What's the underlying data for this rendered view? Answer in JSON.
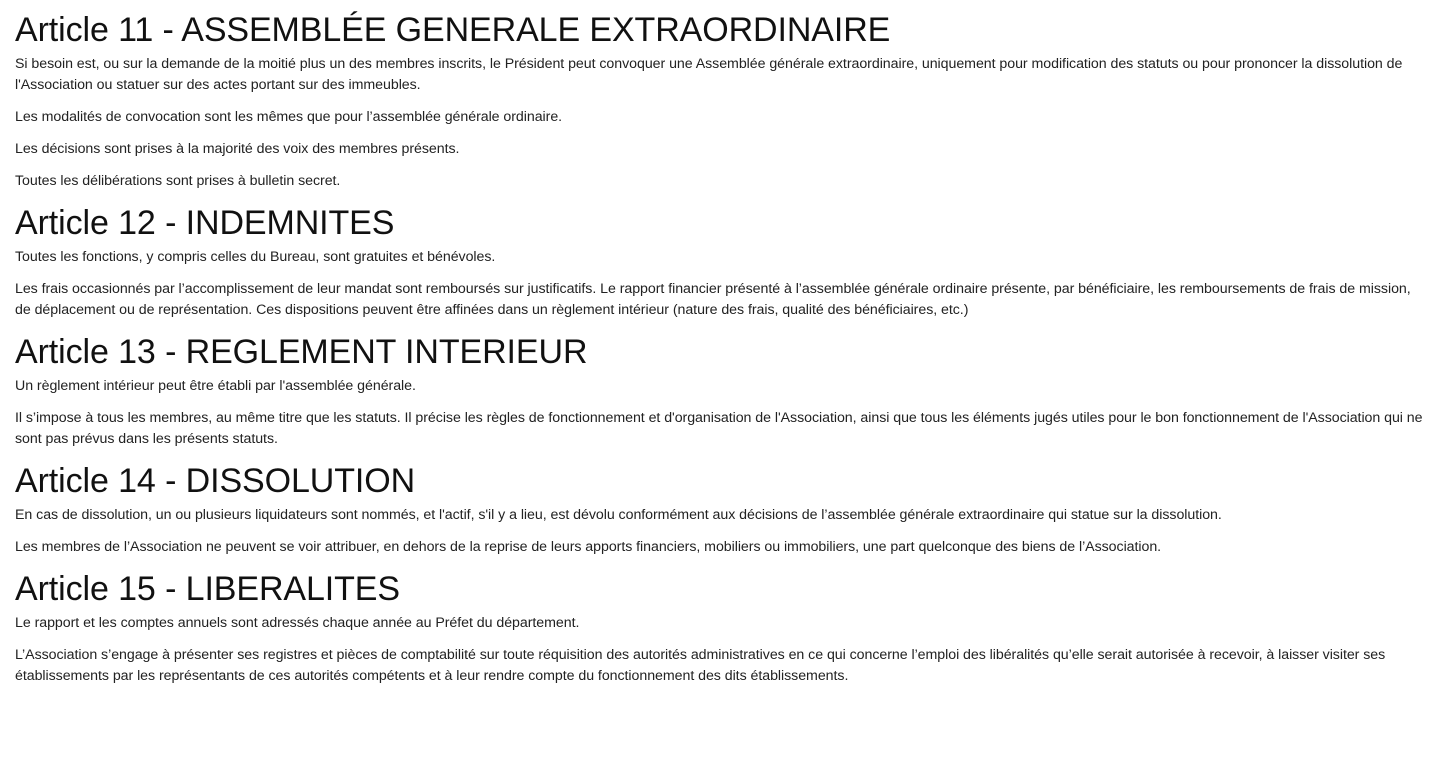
{
  "articles": [
    {
      "title": "Article 11 - ASSEMBLÉE GENERALE EXTRAORDINAIRE",
      "paragraphs": [
        "Si besoin est, ou sur la demande de la moitié plus un des membres inscrits, le Président peut convoquer une Assemblée générale extraordinaire, uniquement pour modification des statuts ou pour prononcer la dissolution de l'Association ou statuer sur des actes portant sur des immeubles.",
        "Les modalités de convocation sont les mêmes que pour l’assemblée générale ordinaire.",
        "Les décisions sont prises à la majorité des voix des membres présents.",
        "Toutes les délibérations sont prises à bulletin secret."
      ]
    },
    {
      "title": "Article 12 - INDEMNITES",
      "paragraphs": [
        "Toutes les fonctions, y compris celles du Bureau, sont gratuites et bénévoles.",
        "Les frais occasionnés par l’accomplissement de leur mandat sont remboursés sur justificatifs. Le rapport financier présenté à l’assemblée générale ordinaire présente, par bénéficiaire, les remboursements de frais de mission, de déplacement ou de représentation. Ces dispositions peuvent être affinées dans un règlement intérieur (nature des frais, qualité des bénéficiaires, etc.)"
      ]
    },
    {
      "title": "Article 13 - REGLEMENT INTERIEUR",
      "paragraphs": [
        "Un règlement intérieur peut être établi par l'assemblée générale.",
        "Il s’impose à tous les membres, au même titre que les statuts. Il précise les règles de fonctionnement et d'organisation de l'Association, ainsi que tous les éléments jugés utiles pour le bon fonctionnement de l'Association qui ne sont pas prévus dans les présents statuts."
      ]
    },
    {
      "title": "Article 14 - DISSOLUTION",
      "paragraphs": [
        "En cas de dissolution, un ou plusieurs liquidateurs sont nommés, et l'actif, s'il y a lieu, est dévolu conformément aux décisions de l’assemblée générale extraordinaire qui statue sur la dissolution.",
        "Les membres de l’Association ne peuvent se voir attribuer, en dehors de la reprise de leurs apports financiers, mobiliers ou immobiliers, une part quelconque des biens de l’Association."
      ]
    },
    {
      "title": "Article 15 - LIBERALITES",
      "paragraphs": [
        "Le rapport et les comptes annuels sont adressés chaque année au Préfet du département.",
        "L’Association s’engage à présenter ses registres et pièces de comptabilité sur toute réquisition des autorités administratives en ce qui concerne l’emploi des libéralités qu’elle serait autorisée à recevoir, à laisser visiter ses établissements par les représentants de ces autorités compétents et à leur rendre compte du fonctionnement des dits établissements."
      ]
    }
  ]
}
